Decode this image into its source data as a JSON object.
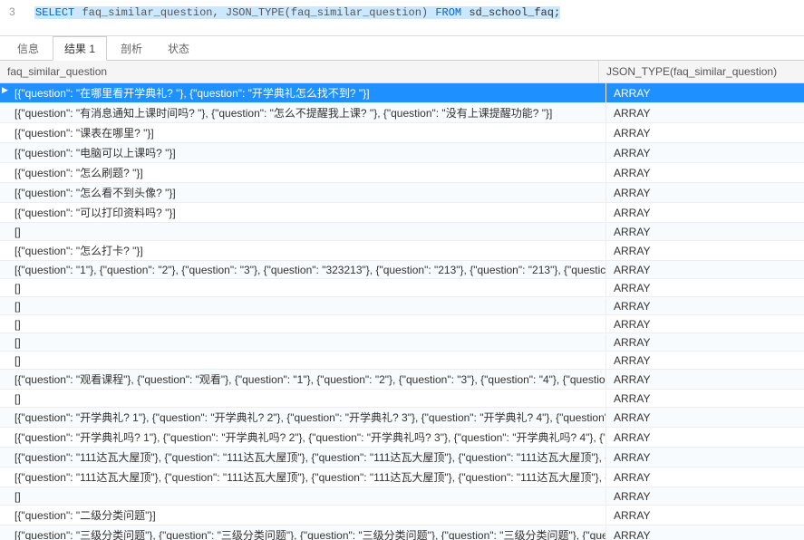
{
  "sql": {
    "line_number": "3",
    "text_parts": {
      "select": "SELECT",
      "cols": " faq_similar_question, JSON_TYPE(faq_similar_question) ",
      "from": "FROM",
      "tbl": " sd_school_faq;"
    }
  },
  "tabs": [
    {
      "label": "信息",
      "active": false
    },
    {
      "label": "结果 1",
      "active": true
    },
    {
      "label": "剖析",
      "active": false
    },
    {
      "label": "状态",
      "active": false
    }
  ],
  "columns": {
    "col1": "faq_similar_question",
    "col2": "JSON_TYPE(faq_similar_question)"
  },
  "rows": [
    {
      "c1": "[{\"question\": \"在哪里看开学典礼? \"}, {\"question\": \"开学典礼怎么找不到? \"}]",
      "c2": "ARRAY",
      "selected": true
    },
    {
      "c1": "[{\"question\": \"有消息通知上课时间吗? \"}, {\"question\": \"怎么不提醒我上课? \"}, {\"question\": \"没有上课提醒功能? \"}]",
      "c2": "ARRAY"
    },
    {
      "c1": "[{\"question\": \"课表在哪里? \"}]",
      "c2": "ARRAY"
    },
    {
      "c1": "[{\"question\": \"电脑可以上课吗? \"}]",
      "c2": "ARRAY"
    },
    {
      "c1": "[{\"question\": \"怎么刷题? \"}]",
      "c2": "ARRAY"
    },
    {
      "c1": "[{\"question\": \"怎么看不到头像? \"}]",
      "c2": "ARRAY"
    },
    {
      "c1": "[{\"question\": \"可以打印资料吗? \"}]",
      "c2": "ARRAY"
    },
    {
      "c1": "[]",
      "c2": "ARRAY"
    },
    {
      "c1": "[{\"question\": \"怎么打卡? \"}]",
      "c2": "ARRAY"
    },
    {
      "c1": "[{\"question\": \"1\"}, {\"question\": \"2\"}, {\"question\": \"3\"}, {\"question\": \"323213\"}, {\"question\": \"213\"}, {\"question\": \"213\"}, {\"questic",
      "c2": "ARRAY"
    },
    {
      "c1": "[]",
      "c2": "ARRAY"
    },
    {
      "c1": "[]",
      "c2": "ARRAY"
    },
    {
      "c1": "[]",
      "c2": "ARRAY"
    },
    {
      "c1": "[]",
      "c2": "ARRAY"
    },
    {
      "c1": "[]",
      "c2": "ARRAY"
    },
    {
      "c1": "[{\"question\": \"观看课程\"}, {\"question\": \"观看\"}, {\"question\": \"1\"}, {\"question\": \"2\"}, {\"question\": \"3\"}, {\"question\": \"4\"}, {\"questio",
      "c2": "ARRAY"
    },
    {
      "c1": "[]",
      "c2": "ARRAY"
    },
    {
      "c1": "[{\"question\": \"开学典礼? 1\"}, {\"question\": \"开学典礼? 2\"}, {\"question\": \"开学典礼? 3\"}, {\"question\": \"开学典礼? 4\"}, {\"question\": ",
      "c2": "ARRAY"
    },
    {
      "c1": "[{\"question\": \"开学典礼吗? 1\"}, {\"question\": \"开学典礼吗? 2\"}, {\"question\": \"开学典礼吗? 3\"}, {\"question\": \"开学典礼吗? 4\"}, {\"q",
      "c2": "ARRAY"
    },
    {
      "c1": "[{\"question\": \"111达瓦大屋顶\"}, {\"question\": \"111达瓦大屋顶\"}, {\"question\": \"111达瓦大屋顶\"}, {\"question\": \"111达瓦大屋顶\"}, {\"c",
      "c2": "ARRAY"
    },
    {
      "c1": "[{\"question\": \"111达瓦大屋顶\"}, {\"question\": \"111达瓦大屋顶\"}, {\"question\": \"111达瓦大屋顶\"}, {\"question\": \"111达瓦大屋顶\"}, {\"c",
      "c2": "ARRAY"
    },
    {
      "c1": "[]",
      "c2": "ARRAY"
    },
    {
      "c1": "[{\"question\": \"二级分类问题\"}]",
      "c2": "ARRAY"
    },
    {
      "c1": "[{\"question\": \"三级分类问题\"}, {\"question\": \"三级分类问题\"}, {\"question\": \"三级分类问题\"}, {\"question\": \"三级分类问题\"}, {\"questic",
      "c2": "ARRAY"
    }
  ]
}
